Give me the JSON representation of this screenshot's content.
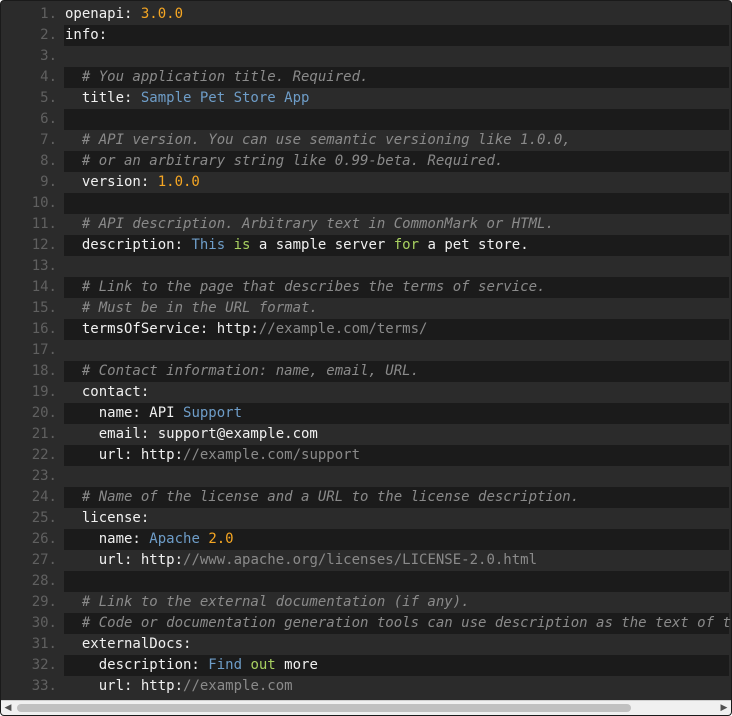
{
  "editor": {
    "lines": [
      {
        "n": "1.",
        "alt": false,
        "tokens": [
          [
            "key",
            "openapi: "
          ],
          [
            "num",
            "3.0.0"
          ]
        ]
      },
      {
        "n": "2.",
        "alt": true,
        "tokens": [
          [
            "key",
            "info:"
          ]
        ]
      },
      {
        "n": "3.",
        "alt": false,
        "tokens": []
      },
      {
        "n": "4.",
        "alt": true,
        "tokens": [
          [
            "key",
            "  "
          ],
          [
            "com",
            "# You application title. Required."
          ]
        ]
      },
      {
        "n": "5.",
        "alt": false,
        "tokens": [
          [
            "key",
            "  title: "
          ],
          [
            "str",
            "Sample Pet Store App"
          ]
        ]
      },
      {
        "n": "6.",
        "alt": true,
        "tokens": []
      },
      {
        "n": "7.",
        "alt": false,
        "tokens": [
          [
            "key",
            "  "
          ],
          [
            "com",
            "# API version. You can use semantic versioning like 1.0.0,"
          ]
        ]
      },
      {
        "n": "8.",
        "alt": true,
        "tokens": [
          [
            "key",
            "  "
          ],
          [
            "com",
            "# or an arbitrary string like 0.99-beta. Required."
          ]
        ]
      },
      {
        "n": "9.",
        "alt": false,
        "tokens": [
          [
            "key",
            "  version: "
          ],
          [
            "num",
            "1.0.0"
          ]
        ]
      },
      {
        "n": "10.",
        "alt": true,
        "tokens": []
      },
      {
        "n": "11.",
        "alt": false,
        "tokens": [
          [
            "key",
            "  "
          ],
          [
            "com",
            "# API description. Arbitrary text in CommonMark or HTML."
          ]
        ]
      },
      {
        "n": "12.",
        "alt": true,
        "tokens": [
          [
            "key",
            "  description: "
          ],
          [
            "str",
            "This "
          ],
          [
            "kw",
            "is"
          ],
          [
            "key",
            " a sample server "
          ],
          [
            "kw",
            "for"
          ],
          [
            "key",
            " a pet store."
          ]
        ]
      },
      {
        "n": "13.",
        "alt": false,
        "tokens": []
      },
      {
        "n": "14.",
        "alt": true,
        "tokens": [
          [
            "key",
            "  "
          ],
          [
            "com",
            "# Link to the page that describes the terms of service."
          ]
        ]
      },
      {
        "n": "15.",
        "alt": false,
        "tokens": [
          [
            "key",
            "  "
          ],
          [
            "com",
            "# Must be in the URL format."
          ]
        ]
      },
      {
        "n": "16.",
        "alt": true,
        "tokens": [
          [
            "key",
            "  termsOfService: http:"
          ],
          [
            "url",
            "//example.com/terms/"
          ]
        ]
      },
      {
        "n": "17.",
        "alt": false,
        "tokens": []
      },
      {
        "n": "18.",
        "alt": true,
        "tokens": [
          [
            "key",
            "  "
          ],
          [
            "com",
            "# Contact information: name, email, URL."
          ]
        ]
      },
      {
        "n": "19.",
        "alt": false,
        "tokens": [
          [
            "key",
            "  contact:"
          ]
        ]
      },
      {
        "n": "20.",
        "alt": true,
        "tokens": [
          [
            "key",
            "    name: API "
          ],
          [
            "str",
            "Support"
          ]
        ]
      },
      {
        "n": "21.",
        "alt": false,
        "tokens": [
          [
            "key",
            "    email: support@example.com"
          ]
        ]
      },
      {
        "n": "22.",
        "alt": true,
        "tokens": [
          [
            "key",
            "    url: http:"
          ],
          [
            "url",
            "//example.com/support"
          ]
        ]
      },
      {
        "n": "23.",
        "alt": false,
        "tokens": []
      },
      {
        "n": "24.",
        "alt": true,
        "tokens": [
          [
            "key",
            "  "
          ],
          [
            "com",
            "# Name of the license and a URL to the license description."
          ]
        ]
      },
      {
        "n": "25.",
        "alt": false,
        "tokens": [
          [
            "key",
            "  license:"
          ]
        ]
      },
      {
        "n": "26.",
        "alt": true,
        "tokens": [
          [
            "key",
            "    name: "
          ],
          [
            "str",
            "Apache "
          ],
          [
            "num",
            "2.0"
          ]
        ]
      },
      {
        "n": "27.",
        "alt": false,
        "tokens": [
          [
            "key",
            "    url: http:"
          ],
          [
            "url",
            "//www.apache.org/licenses/LICENSE-2.0.html"
          ]
        ]
      },
      {
        "n": "28.",
        "alt": true,
        "tokens": []
      },
      {
        "n": "29.",
        "alt": false,
        "tokens": [
          [
            "key",
            "  "
          ],
          [
            "com",
            "# Link to the external documentation (if any)."
          ]
        ]
      },
      {
        "n": "30.",
        "alt": true,
        "tokens": [
          [
            "key",
            "  "
          ],
          [
            "com",
            "# Code or documentation generation tools can use description as the text of th"
          ]
        ]
      },
      {
        "n": "31.",
        "alt": false,
        "tokens": [
          [
            "key",
            "  externalDocs:"
          ]
        ]
      },
      {
        "n": "32.",
        "alt": true,
        "tokens": [
          [
            "key",
            "    description: "
          ],
          [
            "str",
            "Find "
          ],
          [
            "kw",
            "out"
          ],
          [
            "key",
            " more"
          ]
        ]
      },
      {
        "n": "33.",
        "alt": false,
        "tokens": [
          [
            "key",
            "    url: http:"
          ],
          [
            "url",
            "//example.com"
          ]
        ]
      }
    ]
  },
  "scrollbar": {
    "left_arrow": "◀",
    "right_arrow": "▶",
    "thumb_fraction": 0.88
  }
}
